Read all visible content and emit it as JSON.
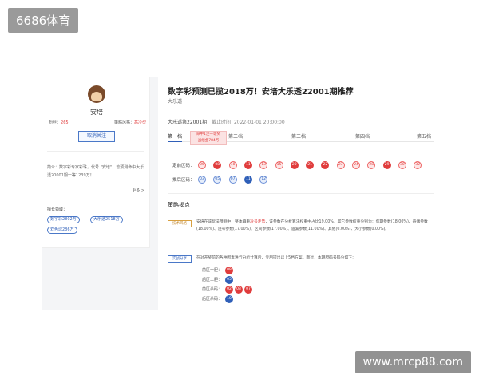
{
  "watermark_top": "6686体育",
  "watermark_bottom": "www.mrcp88.com",
  "colors": {
    "accent": "#2f5fb8",
    "red": "#e03c3c"
  },
  "profile": {
    "avatar_icon": "avatar-icon",
    "name": "安培",
    "stats": {
      "label1": "粉丝：",
      "value1": "265",
      "label2": "策略风格：",
      "value2": "高冷型"
    },
    "follow_label": "取消关注",
    "intro": "简介：数字彩专家彩珠，代号 \"安培\"，曾预测命中大乐透20001期一等1239万！",
    "more_label": "更多 >",
    "record_title": "擅长领域：",
    "tags": [
      "数字彩2802万",
      "大乐透2518万",
      "双色球286万"
    ]
  },
  "article": {
    "title": "数字彩预测已揽2018万！安培大乐透22001期推荐",
    "author": "大乐透",
    "issue": "大乐透第22001期",
    "deadline_label": "截止时间",
    "deadline": "2022-01-01 20:00:00",
    "tabs": [
      "第一档",
      "第二档",
      "第三档",
      "第四档",
      "第五档"
    ],
    "badge": [
      "命中1注一等奖",
      "战绩金784万"
    ],
    "front_label": "定前区码：",
    "back_label": "推后区码：",
    "front_balls": [
      "06",
      "08",
      "10",
      "11",
      "13",
      "15",
      "20",
      "21",
      "22",
      "23",
      "24",
      "28",
      "29",
      "30",
      "32"
    ],
    "back_balls": [
      "03",
      "05",
      "07",
      "11",
      "12"
    ],
    "section_title": "策略揭点",
    "p1_label": "技术风格",
    "p1_text_a": "安培在该玩法预测中，整体偏重",
    "p1_text_red": "冷号走势",
    "p1_text_b": "，该参数在分析算法权重中占比19.00%，其它参数权重分别为：旬期参数(18.00%)、奇偶参数(18.00%)、连号参数(17.00%)、区间参数(17.00%)、遗漏参数(11.00%)、其他(0.00%)、大小参数(0.00%)。",
    "p2_label": "实战分享",
    "p2_text": "在对开奖前的各种因素进行分析计算后，专用提出以上5档方案。面对，本期胆码号码分如下：",
    "zones": [
      {
        "label": "前区一胆：",
        "balls": [
          "08"
        ]
      },
      {
        "label": "后区二胆：",
        "balls": [
          "05"
        ]
      },
      {
        "label": "前区杀码：",
        "balls": [
          "02",
          "03",
          "07"
        ]
      },
      {
        "label": "后区杀码：",
        "balls": [
          "10"
        ]
      }
    ]
  }
}
